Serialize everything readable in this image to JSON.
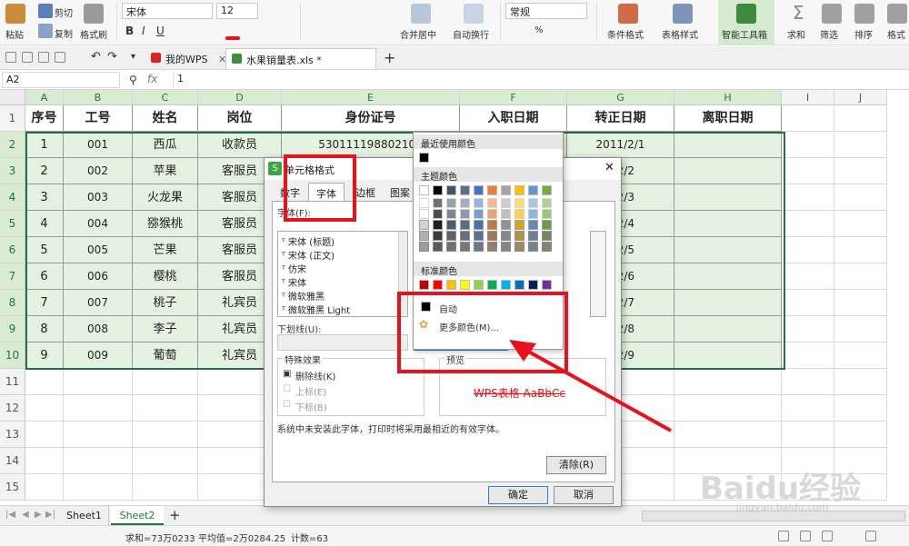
{
  "ribbon": {
    "paste": "粘贴",
    "cut": "剪切",
    "copy": "复制",
    "format_painter": "格式刷",
    "font_name": "宋体",
    "font_size": "12",
    "merge_center": "合并居中",
    "wrap_text": "自动换行",
    "number_format": "常规",
    "cond_format": "条件格式",
    "table_style": "表格样式",
    "smart_toolbox": "智能工具箱",
    "sum": "求和",
    "filter": "筛选",
    "sort": "排序",
    "format": "格式"
  },
  "tabs": {
    "home": "我的WPS",
    "file": "水果销量表.xls *"
  },
  "formula_bar": {
    "name_box": "A2",
    "fx": "fx",
    "value": "1"
  },
  "columns": [
    "A",
    "B",
    "C",
    "D",
    "E",
    "F",
    "G",
    "H",
    "I",
    "J"
  ],
  "rows": [
    "1",
    "2",
    "3",
    "4",
    "5",
    "6",
    "7",
    "8",
    "9",
    "10",
    "11",
    "12",
    "13",
    "14",
    "15"
  ],
  "table": {
    "headers": [
      "序号",
      "工号",
      "姓名",
      "岗位",
      "身份证号",
      "入职日期",
      "转正日期",
      "离职日期"
    ],
    "data": [
      [
        "1",
        "001",
        "西瓜",
        "收款员",
        "530111198802103",
        "",
        "2011/2/1",
        ""
      ],
      [
        "2",
        "002",
        "苹果",
        "客服员",
        "",
        "",
        "1/2/2",
        ""
      ],
      [
        "3",
        "003",
        "火龙果",
        "客服员",
        "",
        "",
        "1/2/3",
        ""
      ],
      [
        "4",
        "004",
        "猕猴桃",
        "客服员",
        "",
        "",
        "1/2/4",
        ""
      ],
      [
        "5",
        "005",
        "芒果",
        "客服员",
        "",
        "",
        "1/2/5",
        ""
      ],
      [
        "6",
        "006",
        "樱桃",
        "客服员",
        "",
        "",
        "1/2/6",
        ""
      ],
      [
        "7",
        "007",
        "桃子",
        "礼宾员",
        "",
        "",
        "1/2/7",
        ""
      ],
      [
        "8",
        "008",
        "李子",
        "礼宾员",
        "",
        "",
        "1/2/8",
        ""
      ],
      [
        "9",
        "009",
        "葡萄",
        "礼宾员",
        "",
        "",
        "1/2/9",
        ""
      ]
    ]
  },
  "sheets": [
    "Sheet1",
    "Sheet2"
  ],
  "status": {
    "sum": "求和=73万0233",
    "avg": "平均值=2万0284.25",
    "count": "计数=63"
  },
  "dialog": {
    "title": "单元格格式",
    "tabs": [
      "数字",
      "字体",
      "边框",
      "图案"
    ],
    "font_label": "字体(F):",
    "fonts": [
      "宋体 (标题)",
      "宋体 (正文)",
      "仿宋",
      "宋体",
      "微软雅黑",
      "微软雅黑 Light"
    ],
    "underline_label": "下划线(U):",
    "effects_label": "特殊效果",
    "strike": "删除线(K)",
    "superscript": "上标(E)",
    "subscript": "下标(B)",
    "preview_label": "预览",
    "preview_text": "WPS表格  AaBbCc",
    "note": "系统中未安装此字体，打印时将采用最相近的有效字体。",
    "clear": "清除(R)",
    "ok": "确定",
    "cancel": "取消"
  },
  "palette": {
    "recent": "最近使用颜色",
    "theme": "主题颜色",
    "standard": "标准颜色",
    "auto": "自动",
    "more": "更多颜色(M)..."
  },
  "colors": {
    "accent_green": "#217346",
    "selected_red": "#e8121c",
    "theme_row": [
      "#ffffff",
      "#000000",
      "#44546a",
      "#5b6f8e",
      "#4472c4",
      "#ed7d31",
      "#a5a5a5",
      "#ffc000",
      "#5b9bd5",
      "#70ad47"
    ],
    "standard_row": [
      "#c00000",
      "#ff0000",
      "#ffc000",
      "#ffff00",
      "#92d050",
      "#00b050",
      "#00b0f0",
      "#0070c0",
      "#002060",
      "#7030a0"
    ]
  },
  "watermark": "Baidu经验",
  "watermark_url": "jingyan.baidu.com"
}
